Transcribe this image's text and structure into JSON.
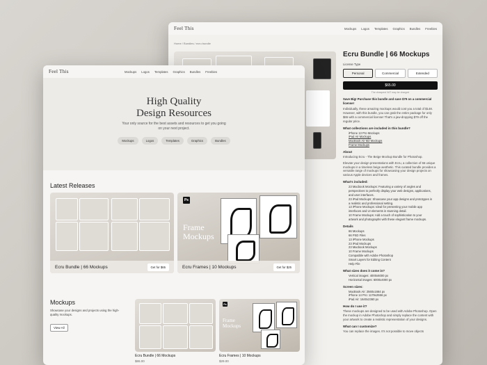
{
  "back": {
    "logo": "Feel This",
    "nav": [
      "Mockups",
      "Logos",
      "Templates",
      "Graphics",
      "Bundles",
      "Freebies"
    ],
    "breadcrumb": [
      "Home",
      "/",
      "Bundles",
      "/",
      "ecru bundle"
    ],
    "product": {
      "title": "Ecru Bundle | 66 Mockups",
      "license_label": "License Type",
      "licenses": [
        "Personal",
        "Commercial",
        "Extended"
      ],
      "selected_license": "Personal",
      "buy_label": "$65.00",
      "note": "The cheapest VAT may be charged",
      "save_text": "Save Big! Purchase this bundle and save $79 on a commercial license!",
      "desc1": "Individually, these amazing mockups would cost you a total of $148. However, with this bundle, you can grab the entire package for only $65 with a commercial license! That's a jaw-dropping $79 off the regular price.",
      "collections_heading": "What collections are included in this bundle?",
      "collections": [
        "iPhone 13 Pro Mockups",
        "iPad Air Mockups",
        "MacBook Air M2 Mockups",
        "Frame Mockups"
      ],
      "about_heading": "About",
      "about1": "Introducing Ecru - The Beige Mockup Bundle for Photoshop.",
      "about2": "Elevate your design presentations with Ecru, a collection of 66 unique mockups in a timeless beige aesthetic. This curated bundle provides a versatile range of mockups for showcasing your design projects on various Apple devices and frames.",
      "included_heading": "What's included:",
      "included": [
        "23 Macbook Mockups: Featuring a variety of angles and",
        "perspectives to perfectly display your web designs, applications,",
        "and user interfaces.",
        "23 iPad Mockups: Showcase your app designs and prototypes in",
        "a realistic and professional setting.",
        "13 iPhone Mockups: Ideal for presenting your mobile app",
        "interfaces and UI elements in stunning detail.",
        "10 Frame Mockups: Add a touch of sophistication to your",
        "artwork and photographs with these elegant frame mockups."
      ],
      "details_heading": "Details",
      "details": [
        "66 Mockups",
        "66 PSD Files",
        "13 iPhone Mockups",
        "23 iPad Mockups",
        "23 Macbook Mockups",
        "10 Frame Mockups",
        "Compatible with Adobe Photoshop",
        "Smart Layers for Editing Content",
        "Help File"
      ],
      "sizes_heading": "What sizes does it come in?",
      "sizes": [
        "Vertical images: 4000x6000 px",
        "Horizontal images: 6000x4000 px"
      ],
      "screens_heading": "Screen sizes:",
      "screens": [
        "MacBook Air: 2560x1664 px",
        "iPhone 14 Pro: 1179x2556 px",
        "iPad Air: 1640x2360 px"
      ],
      "howuse_heading": "How do I use it?",
      "howuse": "These mockups are designed to be used with Adobe Photoshop. Open the mockup in Adobe Photoshop and simply replace the content with your artwork to create a realistic representation of your designs.",
      "customize_heading": "What can I customize?",
      "customize": "You can replace the images. It's not possible to move objects"
    }
  },
  "front": {
    "logo": "Feel This",
    "nav": [
      "Mockups",
      "Logos",
      "Templates",
      "Graphics",
      "Bundles",
      "Freebies"
    ],
    "hero": {
      "title_line1": "High Quality",
      "title_line2": "Design Resources",
      "sub_line1": "Your only source for the best assets and resources to get you going",
      "sub_line2": "on your next project.",
      "chips": [
        "Mockups",
        "Logos",
        "Templates",
        "Graphics",
        "Bundles"
      ]
    },
    "latest_heading": "Latest Releases",
    "cards": [
      {
        "title": "Ecru Bundle | 66 Mockups",
        "button": "Get for $65"
      },
      {
        "title": "Ecru Frames | 10 Mockups",
        "button": "Get for $25",
        "overlay": [
          "Frame",
          "Mockups"
        ],
        "badge": "Ps"
      }
    ],
    "mockups": {
      "heading": "Mockups",
      "desc": "Showcase your designs and projects using the high-quality mockups.",
      "view_all": "View All",
      "items": [
        {
          "title": "Ecru Bundle | 66 Mockups",
          "price": "$65.00"
        },
        {
          "title": "Ecru Frames | 10 Mockups",
          "price": "$29.00",
          "overlay": [
            "Frame",
            "Mockups"
          ],
          "badge": "Ps"
        }
      ]
    }
  },
  "colors": {
    "dark": "#111111",
    "bg": "#f3f1ee",
    "accent_bg": "#ecebe8"
  }
}
